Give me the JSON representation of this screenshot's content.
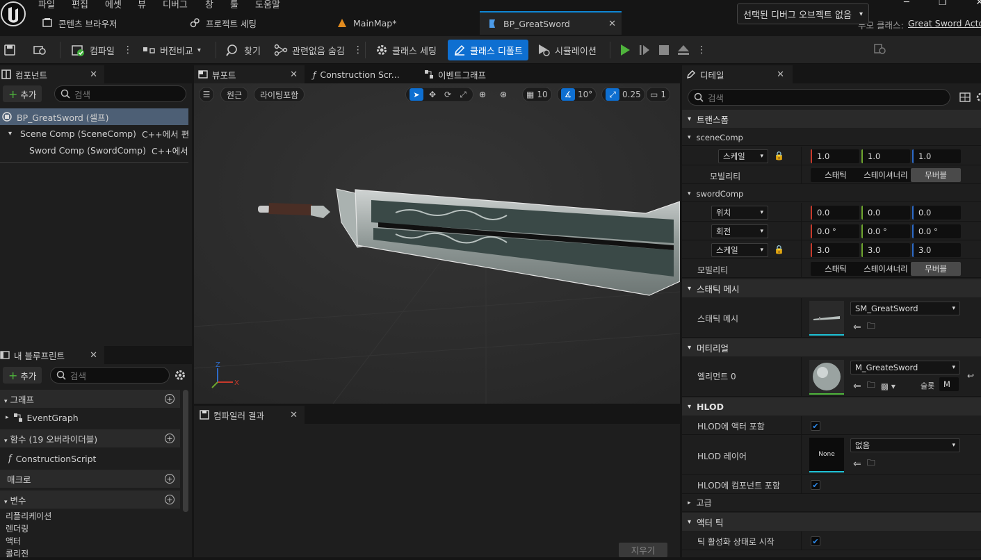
{
  "menu": [
    "파일",
    "편집",
    "에셋",
    "뷰",
    "디버그",
    "창",
    "툴",
    "도움말"
  ],
  "tabs": {
    "content_browser": "콘텐츠 브라우저",
    "project_settings": "프로젝트 세팅",
    "main_map": "MainMap*",
    "bp": "BP_GreatSword",
    "parent_label": "부모 클래스:",
    "parent_value": "Great Sword Actor"
  },
  "toolbar": {
    "compile": "컴파일",
    "diff": "버전비교",
    "find": "찾기",
    "hide_unrelated": "관련없음 숨김",
    "class_settings": "클래스 세팅",
    "class_defaults": "클래스 디폴트",
    "simulation": "시뮬레이션",
    "debug_object": "선택된 디버그 오브젝트 없음"
  },
  "components": {
    "title": "컴포넌트",
    "add": "추가",
    "search_placeholder": "검색",
    "root": "BP_GreatSword (셀프)",
    "items": [
      {
        "name": "Scene Comp (SceneComp)",
        "note": "C++에서 편"
      },
      {
        "name": "Sword Comp (SwordComp)",
        "note": "C++에서 >"
      }
    ]
  },
  "my_blueprint": {
    "title": "내 블루프린트",
    "add": "추가",
    "search_placeholder": "검색",
    "graphs_header": "그래프",
    "event_graph": "EventGraph",
    "functions_header": "함수 (19 오버라이더블)",
    "construction_script": "ConstructionScript",
    "macros_header": "매크로",
    "variables_header": "변수",
    "variable_categories": [
      "리플리케이션",
      "렌더링",
      "액터",
      "콜리전"
    ]
  },
  "viewport": {
    "tabs": [
      "뷰포트",
      "Construction Scr...",
      "이벤트그래프"
    ],
    "perspective": "원근",
    "lighting": "라이팅포함",
    "grid_snap": "10",
    "rot_snap": "10°",
    "scale_snap": "0.25",
    "cam_speed": "1"
  },
  "compiler": {
    "title": "컴파일러 결과",
    "clear": "지우기"
  },
  "details": {
    "title": "디테일",
    "search_placeholder": "검색",
    "transform_header": "트랜스폼",
    "scene_comp": {
      "label": "sceneComp",
      "scale_label": "스케일",
      "scale": [
        "1.0",
        "1.0",
        "1.0"
      ],
      "mobility_label": "모빌리티",
      "mobility_options": [
        "스태틱",
        "스테이셔너리",
        "무버블"
      ],
      "mobility_selected": "무버블"
    },
    "sword_comp": {
      "label": "swordComp",
      "location_label": "위치",
      "location": [
        "0.0",
        "0.0",
        "0.0"
      ],
      "rotation_label": "회전",
      "rotation": [
        "0.0 °",
        "0.0 °",
        "0.0 °"
      ],
      "scale_label": "스케일",
      "scale": [
        "3.0",
        "3.0",
        "3.0"
      ],
      "mobility_label": "모빌리티",
      "mobility_options": [
        "스태틱",
        "스테이셔너리",
        "무버블"
      ],
      "mobility_selected": "무버블"
    },
    "static_mesh_header": "스태틱 메시",
    "static_mesh_label": "스태틱 메시",
    "static_mesh_value": "SM_GreatSword",
    "materials_header": "머티리얼",
    "element0_label": "엘리먼트 0",
    "material_value": "M_GreateSword",
    "slot_label": "슬롯",
    "slot_value": "M",
    "hlod_header": "HLOD",
    "hlod_include_actor": "HLOD에 액터 포함",
    "hlod_include_actor_checked": true,
    "hlod_layer_label": "HLOD 레이어",
    "hlod_thumb_text": "None",
    "hlod_layer_value": "없음",
    "hlod_include_component": "HLOD에 컴포넌트 포함",
    "hlod_include_component_checked": true,
    "advanced_header": "고급",
    "actor_tick_header": "액터 틱",
    "tick_start_enabled": "틱 활성화 상태로 시작",
    "tick_start_enabled_checked": true
  },
  "colors": {
    "accent": "#0e6fd1",
    "selection": "#4d5f75",
    "axis_x": "#c8392b",
    "axis_y": "#6da52e",
    "axis_z": "#2d6bc8",
    "play_green": "#4fb43c"
  }
}
